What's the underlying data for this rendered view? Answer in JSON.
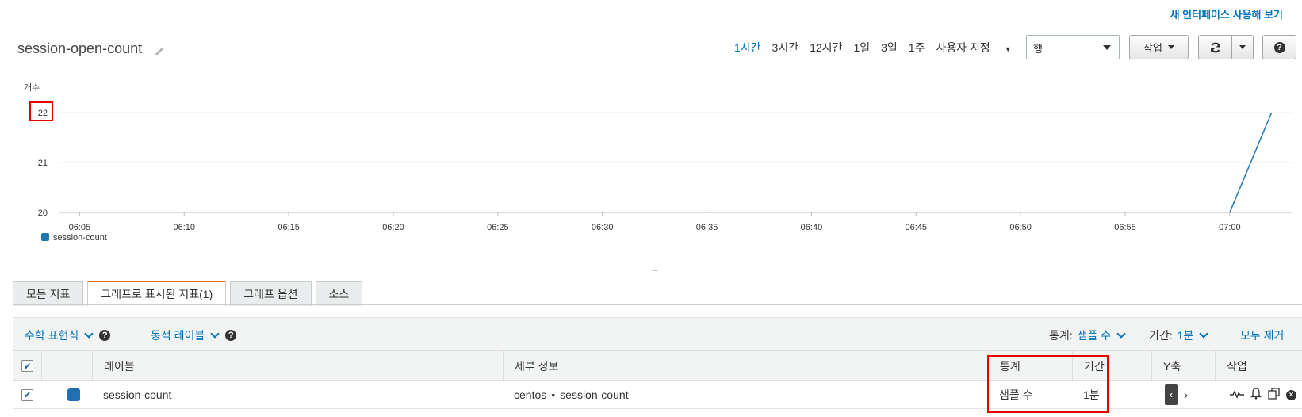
{
  "header": {
    "new_ui_link": "새 인터페이스 사용해 보기",
    "title": "session-open-count",
    "ranges": [
      "1시간",
      "3시간",
      "12시간",
      "1일",
      "3일",
      "1주"
    ],
    "active_range": "1시간",
    "custom_range": "사용자 지정",
    "view_select": "행",
    "actions_button": "작업",
    "refresh_icon": "refresh-icon",
    "help_icon": "help-icon"
  },
  "chart_data": {
    "type": "line",
    "ylabel": "개수",
    "ylim": [
      20,
      22
    ],
    "yticks": [
      "22",
      "21",
      "20"
    ],
    "x_ticks": [
      "06:05",
      "06:10",
      "06:15",
      "06:20",
      "06:25",
      "06:30",
      "06:35",
      "06:40",
      "06:45",
      "06:50",
      "06:55",
      "07:00"
    ],
    "x_range": [
      "06:04",
      "07:03"
    ],
    "series": [
      {
        "name": "session-count",
        "color": "#1f77b4",
        "points": [
          {
            "x": "07:00",
            "y": 20
          },
          {
            "x": "07:02",
            "y": 22
          }
        ]
      }
    ],
    "grid": true,
    "legend": "bottom-left"
  },
  "resize_handle": "---",
  "tabs": [
    {
      "label": "모든 지표",
      "active": false
    },
    {
      "label": "그래프로 표시된 지표(1)",
      "active": true
    },
    {
      "label": "그래프 옵션",
      "active": false
    },
    {
      "label": "소스",
      "active": false
    }
  ],
  "toolbar": {
    "math_expression": "수학 표현식",
    "dynamic_labels": "동적 레이블",
    "statistic_label": "통계:",
    "statistic_value": "샘플 수",
    "period_label": "기간:",
    "period_value": "1분",
    "remove_all": "모두 제거"
  },
  "table": {
    "columns": {
      "label": "레이블",
      "details": "세부 정보",
      "statistic": "통계",
      "period": "기간",
      "y_axis": "Y축",
      "actions": "작업"
    },
    "rows": [
      {
        "checked": true,
        "color": "#1f6fb5",
        "label": "session-count",
        "details_namespace": "centos",
        "details_separator": "•",
        "details_metric": "session-count",
        "statistic": "샘플 수",
        "period": "1분"
      }
    ]
  }
}
